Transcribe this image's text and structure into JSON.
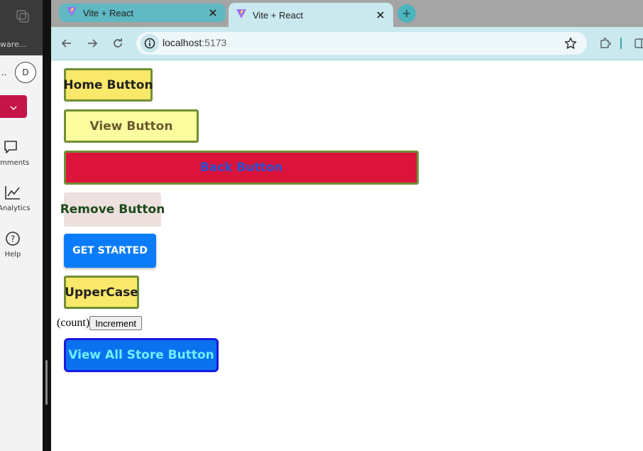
{
  "left_app": {
    "ware_text": "ware...",
    "dots": "..",
    "avatar_initial": "D",
    "nav": [
      {
        "label": "omments",
        "icon": "comment-icon"
      },
      {
        "label": "Analytics",
        "icon": "analytics-icon"
      },
      {
        "label": "Help",
        "icon": "help-icon"
      }
    ]
  },
  "browser": {
    "tabs": [
      {
        "title": "Vite + React",
        "active": false
      },
      {
        "title": "Vite + React",
        "active": true
      }
    ],
    "url_host": "localhost",
    "url_port": ":5173"
  },
  "page": {
    "home_button": "Home Button",
    "view_button": "View Button",
    "back_button": "Back Button",
    "remove_button": "Remove Button",
    "get_started_button": "GET STARTED",
    "uppercase_button": "UpperCase",
    "count_text": "(count)",
    "increment_button": "Increment",
    "view_all_store_button": "View All Store Button"
  },
  "colors": {
    "tab_strip": "#a5a5a5",
    "toolbar": "#c9e9ee",
    "back_button_bg": "#dc143c",
    "get_started_bg": "#0a7cf9",
    "view_all_bg": "#0b72ef"
  }
}
